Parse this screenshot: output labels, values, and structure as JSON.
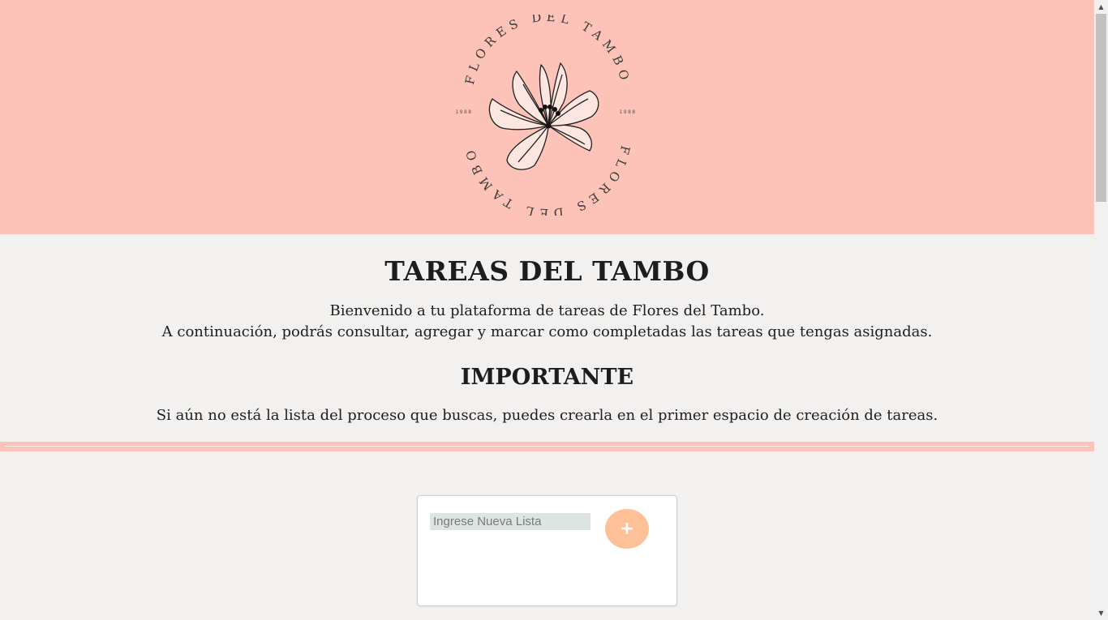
{
  "header": {
    "logo": {
      "text_top": "FLORES DEL TAMBO",
      "text_bottom": "FLORES DEL TAMBO",
      "year_left": "1988",
      "year_right": "1988",
      "icon": "flower-icon"
    }
  },
  "intro": {
    "title": "TAREAS DEL TAMBO",
    "welcome_line1": "Bienvenido a tu plataforma de tareas de Flores del Tambo.",
    "welcome_line2": "A continuación, podrás consultar, agregar y marcar como completadas las tareas que tengas asignadas.",
    "important_heading": "IMPORTANTE",
    "important_note": "Si aún no está la lista del proceso que buscas, puedes crearla en el primer espacio de creación de tareas."
  },
  "new_list": {
    "input_value": "",
    "placeholder": "Ingrese Nueva Lista",
    "add_label": "+"
  },
  "colors": {
    "header_bg": "#fec3b8",
    "page_bg": "#f3f1f0",
    "input_bg": "#dde5e2",
    "add_button_bg": "#fec197"
  }
}
